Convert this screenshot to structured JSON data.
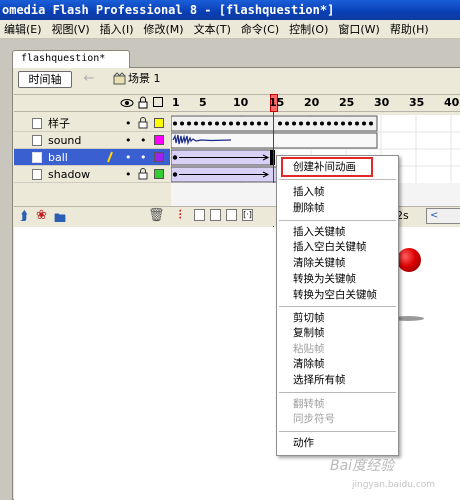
{
  "window": {
    "title": "omedia Flash Professional 8 - [flashquestion*]"
  },
  "menubar": {
    "items": [
      "编辑(E)",
      "视图(V)",
      "插入(I)",
      "修改(M)",
      "文本(T)",
      "命令(C)",
      "控制(O)",
      "窗口(W)",
      "帮助(H)"
    ]
  },
  "document": {
    "tab_label": "flashquestion*"
  },
  "toolbar": {
    "timeline_label": "时间轴",
    "scene_label": "场景 1"
  },
  "timeline": {
    "frame_numbers": [
      "1",
      "5",
      "10",
      "15",
      "20",
      "25",
      "30",
      "35",
      "40"
    ],
    "current_frame": 15,
    "fps_fragment": "2s",
    "layers": [
      {
        "name": "样子",
        "swatch_color": "#ffff00",
        "selected": false
      },
      {
        "name": "sound",
        "swatch_color": "#ff00ff",
        "selected": false
      },
      {
        "name": "ball",
        "swatch_color": "#a020f0",
        "selected": true
      },
      {
        "name": "shadow",
        "swatch_color": "#33cc33",
        "selected": false
      }
    ]
  },
  "context_menu": {
    "items": [
      {
        "label": "创建补间动画",
        "disabled": false,
        "highlighted": true
      },
      {
        "label": "插入帧",
        "disabled": false
      },
      {
        "label": "删除帧",
        "disabled": false
      },
      {
        "label": "插入关键帧",
        "disabled": false
      },
      {
        "label": "插入空白关键帧",
        "disabled": false
      },
      {
        "label": "清除关键帧",
        "disabled": false
      },
      {
        "label": "转换为关键帧",
        "disabled": false
      },
      {
        "label": "转换为空白关键帧",
        "disabled": false
      },
      {
        "label": "剪切帧",
        "disabled": false
      },
      {
        "label": "复制帧",
        "disabled": false
      },
      {
        "label": "粘贴帧",
        "disabled": true
      },
      {
        "label": "清除帧",
        "disabled": false
      },
      {
        "label": "选择所有帧",
        "disabled": false
      },
      {
        "label": "翻转帧",
        "disabled": true
      },
      {
        "label": "同步符号",
        "disabled": true
      },
      {
        "label": "动作",
        "disabled": false
      }
    ]
  },
  "watermark": {
    "text": "Bai度经验",
    "sub": "jingyan.baidu.com"
  },
  "colors": {
    "title_bar": "#0a3fb4",
    "selected_layer": "#3a5fd0",
    "playhead": "#ff6a6a",
    "highlight_box": "#e02a2a"
  }
}
